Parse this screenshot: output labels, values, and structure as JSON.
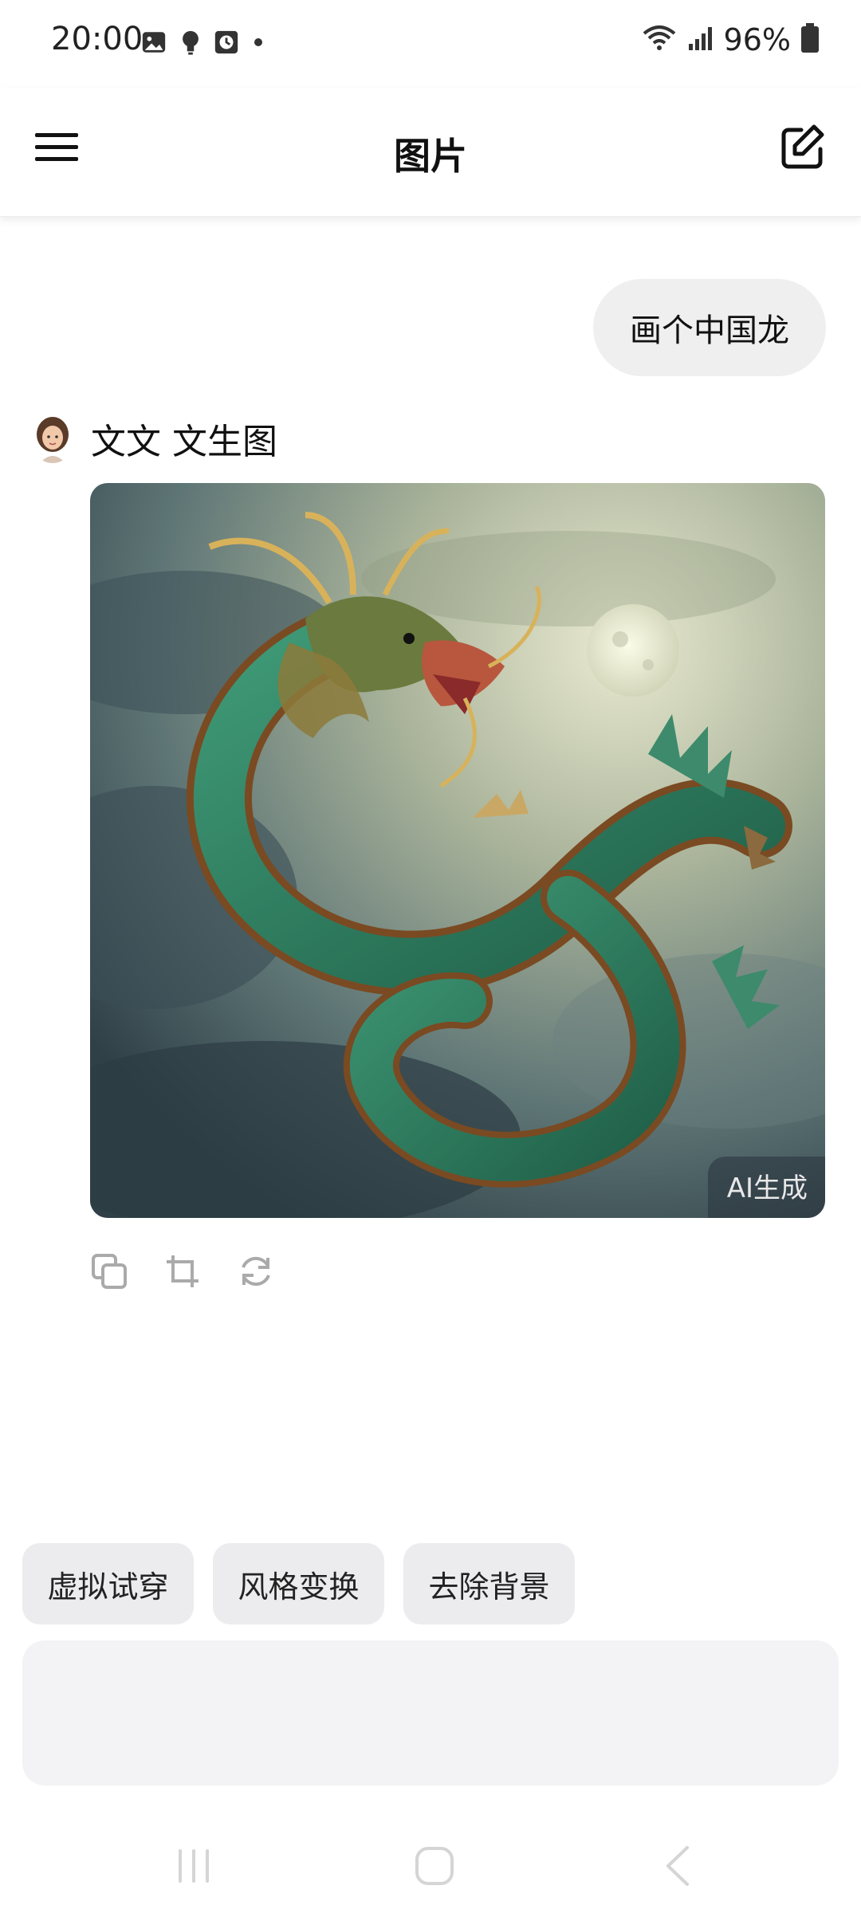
{
  "status_bar": {
    "time": "20:00",
    "battery": "96%",
    "icons_left": [
      "image-icon",
      "bulb-icon",
      "clock-icon",
      "dot-icon"
    ],
    "icons_right": [
      "wifi-icon",
      "signal-icon",
      "battery-icon"
    ]
  },
  "app_bar": {
    "title": "图片",
    "menu_icon": "hamburger-icon",
    "edit_icon": "edit-icon"
  },
  "chat": {
    "user_message": "画个中国龙",
    "bot": {
      "name": "文文 文生图",
      "image_badge": "AI生成",
      "image_subject": "green chinese dragon in cloudy sky with moon",
      "actions": [
        "copy-icon",
        "crop-icon",
        "refresh-icon"
      ]
    }
  },
  "quick_actions": [
    "虚拟试穿",
    "风格变换",
    "去除背景"
  ],
  "input": {
    "placeholder": ""
  },
  "nav_bar": [
    "recent-apps-icon",
    "home-icon",
    "back-icon"
  ],
  "colors": {
    "bubble": "#efefef",
    "chip": "#ececee",
    "input": "#f3f3f5",
    "dragon": "#2f7d5f",
    "sky": "#6f8a8a"
  }
}
